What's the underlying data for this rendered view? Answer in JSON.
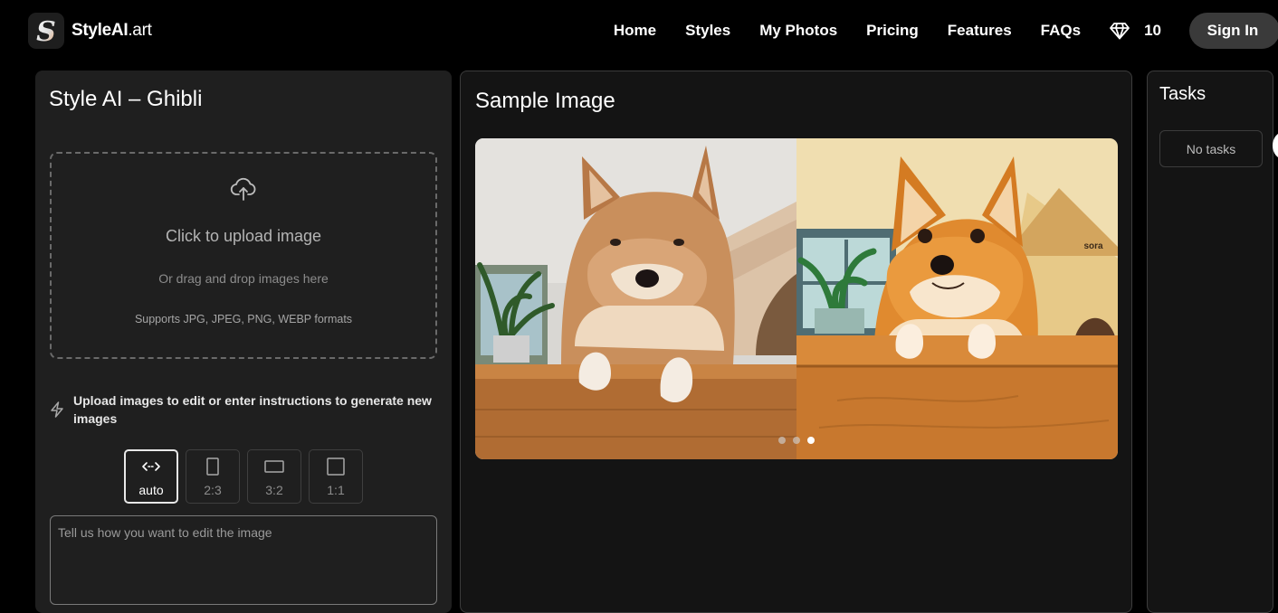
{
  "header": {
    "logo_mark": "S",
    "logo_name": "StyleAI",
    "logo_tld": ".art",
    "nav": [
      "Home",
      "Styles",
      "My Photos",
      "Pricing",
      "Features",
      "FAQs"
    ],
    "credits": "10",
    "credits_icon": "diamond-icon",
    "signin": "Sign In"
  },
  "left": {
    "title": "Style AI – Ghibli",
    "upload_title": "Click to upload image",
    "upload_sub": "Or drag and drop images here",
    "upload_formats": "Supports JPG, JPEG, PNG, WEBP formats",
    "hint": "Upload images to edit or enter instructions to generate new images",
    "ratios": [
      "auto",
      "2:3",
      "3:2",
      "1:1"
    ],
    "selected_ratio": "auto",
    "prompt_placeholder": "Tell us how you want to edit the image",
    "prompt_value": ""
  },
  "middle": {
    "title": "Sample Image",
    "watermark": "sora",
    "carousel_count": 3,
    "carousel_active": 3
  },
  "right": {
    "title": "Tasks",
    "empty": "No tasks"
  },
  "colors": {
    "background": "#000000",
    "panel": "#1f1f1f",
    "signin_bg": "#3a3a3a"
  }
}
